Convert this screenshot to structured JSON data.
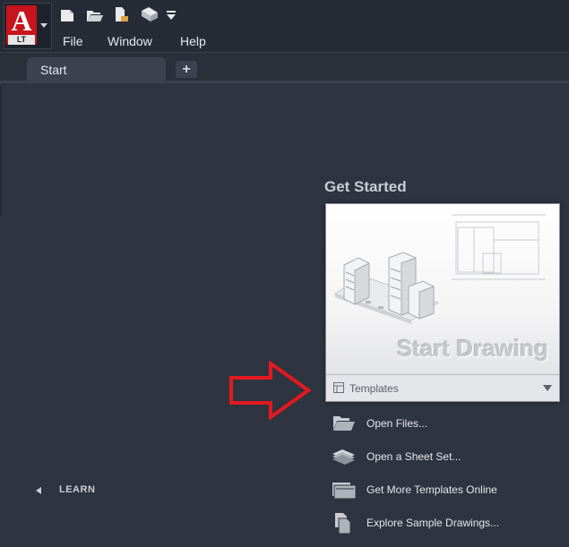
{
  "app": {
    "logo_letter": "A",
    "logo_edition": "LT"
  },
  "quick_access": [
    {
      "icon": "new-file-icon"
    },
    {
      "icon": "open-folder-icon"
    },
    {
      "icon": "save-icon"
    },
    {
      "icon": "plot-icon"
    },
    {
      "icon": "customize-dropdown-icon"
    }
  ],
  "menu": {
    "file": "File",
    "window": "Window",
    "help": "Help"
  },
  "tabs": {
    "start": "Start",
    "add": "+"
  },
  "get_started": {
    "heading": "Get Started",
    "start_drawing": "Start Drawing",
    "templates_label": "Templates"
  },
  "actions": {
    "open_files": "Open Files...",
    "open_sheet_set": "Open a Sheet Set...",
    "more_templates": "Get More Templates Online",
    "sample_drawings": "Explore Sample Drawings..."
  },
  "learn": {
    "label": "LEARN"
  },
  "colors": {
    "background": "#2f3441",
    "topbar": "#272b36",
    "brand_red": "#c8141c",
    "annotation_arrow": "#e3191f"
  }
}
